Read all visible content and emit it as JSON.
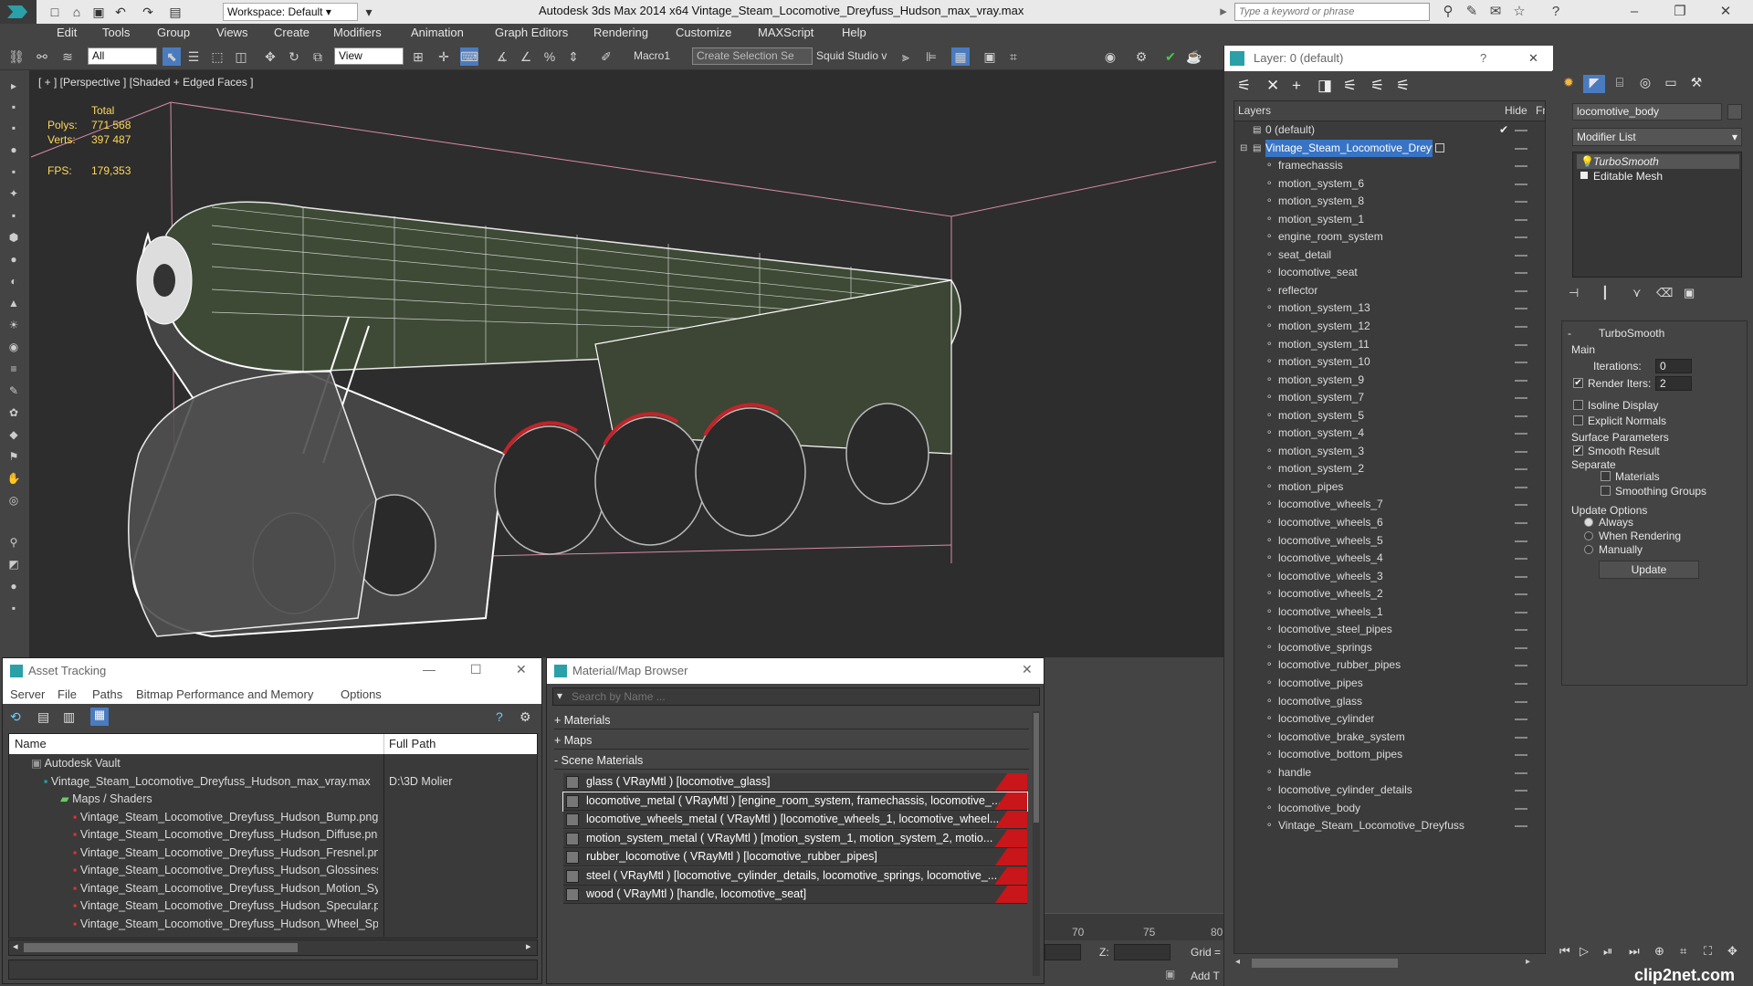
{
  "app": {
    "window_title": "Autodesk 3ds Max  2014 x64     Vintage_Steam_Locomotive_Dreyfuss_Hudson_max_vray.max",
    "workspace": "Workspace: Default",
    "search_placeholder": "Type a keyword or phrase"
  },
  "menu": [
    "Edit",
    "Tools",
    "Group",
    "Views",
    "Create",
    "Modifiers",
    "Animation",
    "Graph Editors",
    "Rendering",
    "Customize",
    "MAXScript",
    "Help"
  ],
  "toolbar": {
    "filter": "All",
    "refcoord": "View",
    "macro": "Macro1",
    "selection_set": "Create Selection Se",
    "squid": "Squid Studio v"
  },
  "viewport": {
    "label": "[ + ] [Perspective ] [Shaded + Edged Faces ]",
    "stats_total": "Total",
    "polys_label": "Polys:",
    "polys": "771 568",
    "verts_label": "Verts:",
    "verts": "397 487",
    "fps_label": "FPS:",
    "fps": "179,353"
  },
  "layers_panel": {
    "title": "Layer: 0 (default)",
    "help": "?",
    "col_layers": "Layers",
    "col_hide": "Hide",
    "col_f": "Fr",
    "default_layer": "0 (default)",
    "selected_layer": "Vintage_Steam_Locomotive_Dreyfuss_H",
    "objects": [
      "framechassis",
      "motion_system_6",
      "motion_system_8",
      "motion_system_1",
      "engine_room_system",
      "seat_detail",
      "locomotive_seat",
      "reflector",
      "motion_system_13",
      "motion_system_12",
      "motion_system_11",
      "motion_system_10",
      "motion_system_9",
      "motion_system_7",
      "motion_system_5",
      "motion_system_4",
      "motion_system_3",
      "motion_system_2",
      "motion_pipes",
      "locomotive_wheels_7",
      "locomotive_wheels_6",
      "locomotive_wheels_5",
      "locomotive_wheels_4",
      "locomotive_wheels_3",
      "locomotive_wheels_2",
      "locomotive_wheels_1",
      "locomotive_steel_pipes",
      "locomotive_springs",
      "locomotive_rubber_pipes",
      "locomotive_pipes",
      "locomotive_glass",
      "locomotive_cylinder",
      "locomotive_brake_system",
      "locomotive_bottom_pipes",
      "handle",
      "locomotive_cylinder_details",
      "locomotive_body",
      "Vintage_Steam_Locomotive_Dreyfuss"
    ]
  },
  "command_panel": {
    "object_name": "locomotive_body",
    "modifier_list": "Modifier List",
    "stack": [
      "TurboSmooth",
      "Editable Mesh"
    ],
    "rollout_title": "TurboSmooth",
    "main": "Main",
    "iterations_label": "Iterations:",
    "iterations": "0",
    "render_iters_label": "Render Iters:",
    "render_iters": "2",
    "isoline": "Isoline Display",
    "explicit": "Explicit Normals",
    "surface_params": "Surface Parameters",
    "smooth_result": "Smooth Result",
    "separate": "Separate",
    "materials": "Materials",
    "smoothing_groups": "Smoothing Groups",
    "update_options": "Update Options",
    "always": "Always",
    "when_rendering": "When Rendering",
    "manually": "Manually",
    "update_btn": "Update"
  },
  "asset_tracking": {
    "title": "Asset Tracking",
    "menu": [
      "Server",
      "File",
      "Paths",
      "Bitmap Performance and Memory",
      "Options"
    ],
    "col_name": "Name",
    "col_path": "Full Path",
    "vault": "Autodesk Vault",
    "file": "Vintage_Steam_Locomotive_Dreyfuss_Hudson_max_vray.max",
    "file_path": "D:\\3D Molier",
    "maps_folder": "Maps / Shaders",
    "maps": [
      "Vintage_Steam_Locomotive_Dreyfuss_Hudson_Bump.png",
      "Vintage_Steam_Locomotive_Dreyfuss_Hudson_Diffuse.png",
      "Vintage_Steam_Locomotive_Dreyfuss_Hudson_Fresnel.png",
      "Vintage_Steam_Locomotive_Dreyfuss_Hudson_Glossiness.png",
      "Vintage_Steam_Locomotive_Dreyfuss_Hudson_Motion_System_...",
      "Vintage_Steam_Locomotive_Dreyfuss_Hudson_Specular.png",
      "Vintage_Steam_Locomotive_Dreyfuss_Hudson_Wheel_Specular...."
    ]
  },
  "material_browser": {
    "title": "Material/Map Browser",
    "search_placeholder": "Search by Name ...",
    "sec_materials": "+ Materials",
    "sec_maps": "+ Maps",
    "sec_scene": "- Scene Materials",
    "items": [
      "glass  ( VRayMtl )  [locomotive_glass]",
      "locomotive_metal  ( VRayMtl )  [engine_room_system, framechassis, locomotive_...",
      "locomotive_wheels_metal  ( VRayMtl )  [locomotive_wheels_1, locomotive_wheel...",
      "motion_system_metal  ( VRayMtl )  [motion_system_1, motion_system_2, motio...",
      "rubber_locomotive  ( VRayMtl )  [locomotive_rubber_pipes]",
      "steel  ( VRayMtl )  [locomotive_cylinder_details, locomotive_springs, locomotive_...",
      "wood  ( VRayMtl )  [handle, locomotive_seat]"
    ]
  },
  "timeline": {
    "ticks": [
      "70",
      "75",
      "80"
    ],
    "z_label": "Z:",
    "grid": "Grid =",
    "add_t": "Add T"
  },
  "watermark": "clip2net.com"
}
